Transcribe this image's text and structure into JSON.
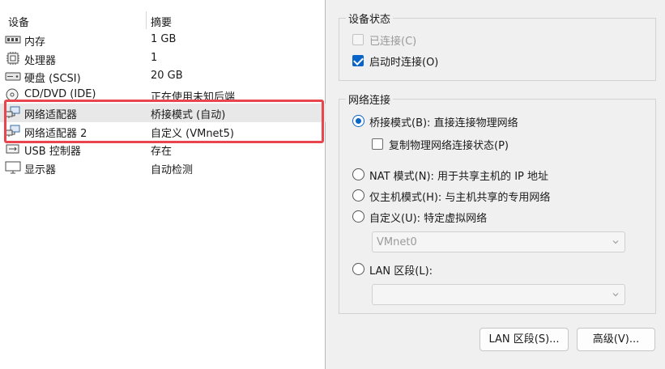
{
  "device_list": {
    "headers": {
      "device": "设备",
      "summary": "摘要"
    },
    "rows": [
      {
        "icon": "memory-icon",
        "name": "内存",
        "summary": "1 GB"
      },
      {
        "icon": "processor-icon",
        "name": "处理器",
        "summary": "1"
      },
      {
        "icon": "hard-disk-icon",
        "name": "硬盘 (SCSI)",
        "summary": "20 GB"
      },
      {
        "icon": "cd-dvd-icon",
        "name": "CD/DVD (IDE)",
        "summary": "正在使用未知后端"
      },
      {
        "icon": "network-adapter-icon",
        "name": "网络适配器",
        "summary": "桥接模式 (自动)"
      },
      {
        "icon": "network-adapter-icon",
        "name": "网络适配器 2",
        "summary": "自定义 (VMnet5)"
      },
      {
        "icon": "usb-controller-icon",
        "name": "USB 控制器",
        "summary": "存在"
      },
      {
        "icon": "display-icon",
        "name": "显示器",
        "summary": "自动检测"
      }
    ],
    "highlight_color": "#e8454f"
  },
  "device_status": {
    "title": "设备状态",
    "connected": {
      "label": "已连接(C)",
      "checked": false,
      "enabled": false
    },
    "connect_at_power_on": {
      "label": "启动时连接(O)",
      "checked": true,
      "enabled": true
    }
  },
  "network_connection": {
    "title": "网络连接",
    "bridged": {
      "label": "桥接模式(B): 直接连接物理网络",
      "selected": true
    },
    "replicate_state": {
      "label": "复制物理网络连接状态(P)",
      "checked": false
    },
    "nat": {
      "label": "NAT 模式(N): 用于共享主机的 IP 地址",
      "selected": false
    },
    "host_only": {
      "label": "仅主机模式(H): 与主机共享的专用网络",
      "selected": false
    },
    "custom": {
      "label": "自定义(U): 特定虚拟网络",
      "selected": false,
      "value": "VMnet0"
    },
    "lan_segment": {
      "label": "LAN 区段(L):",
      "selected": false,
      "value": ""
    }
  },
  "buttons": {
    "lan_segments": "LAN 区段(S)...",
    "advanced": "高级(V)..."
  },
  "accent_color": "#0a64c8"
}
